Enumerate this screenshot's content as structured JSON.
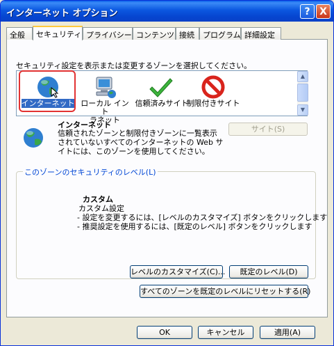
{
  "window": {
    "title": "インターネット オプション",
    "help_label": "?",
    "close_label": "X"
  },
  "tabs": [
    {
      "label": "全般"
    },
    {
      "label": "セキュリティ"
    },
    {
      "label": "プライバシー"
    },
    {
      "label": "コンテンツ"
    },
    {
      "label": "接続"
    },
    {
      "label": "プログラム"
    },
    {
      "label": "詳細設定"
    }
  ],
  "active_tab": "セキュリティ",
  "instruction": "セキュリティ設定を表示または変更するゾーンを選択してください。",
  "zones": [
    {
      "label": "インターネット",
      "icon": "globe-icon",
      "selected": true
    },
    {
      "label": "ローカル イントラネット",
      "label_line1": "ローカル イント",
      "label_line2": "ラネット",
      "icon": "computer-icon"
    },
    {
      "label": "信頼済みサイト",
      "icon": "checkmark-icon"
    },
    {
      "label": "制限付きサイト",
      "icon": "forbidden-icon"
    }
  ],
  "zone_detail": {
    "name": "インターネット",
    "description": "信頼されたゾーンと制限付きゾーンに一覧表示されていないすべてのインターネットの Web サイトには、このゾーンを使用してください。",
    "sites_button": "サイト(S)"
  },
  "security_level": {
    "group_title": "このゾーンのセキュリティのレベル(L)",
    "level_name": "カスタム",
    "desc_line1": "カスタム設定",
    "desc_line2": "- 設定を変更するには、[レベルのカスタマイズ] ボタンをクリックします",
    "desc_line3": "- 推奨設定を使用するには、[既定のレベル] ボタンをクリックします",
    "customize_button": "レベルのカスタマイズ(C)...",
    "default_button": "既定のレベル(D)"
  },
  "reset_all_button": "すべてのゾーンを既定のレベルにリセットする(R)",
  "footer": {
    "ok": "OK",
    "cancel": "キャンセル",
    "apply": "適用(A)"
  },
  "colors": {
    "titlebar": "#0b57e0",
    "selection": "#316ac5",
    "highlight_ring": "#e23232",
    "group_title": "#0046d5"
  }
}
